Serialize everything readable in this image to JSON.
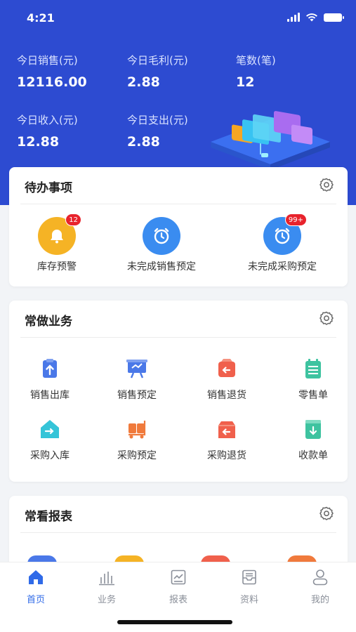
{
  "status_bar": {
    "time": "4:21"
  },
  "stats": [
    {
      "label": "今日销售(元)",
      "value": "12116.00"
    },
    {
      "label": "今日毛利(元)",
      "value": "2.88"
    },
    {
      "label": "笔数(笔)",
      "value": "12"
    },
    {
      "label": "今日收入(元)",
      "value": "12.88"
    },
    {
      "label": "今日支出(元)",
      "value": "2.88"
    }
  ],
  "todo": {
    "title": "待办事项",
    "items": [
      {
        "label": "库存预警",
        "badge": "12",
        "icon": "bell-icon",
        "color": "#f5b325"
      },
      {
        "label": "未完成销售预定",
        "badge": "",
        "icon": "alarm-clock-icon",
        "color": "#3a8cf0"
      },
      {
        "label": "未完成采购预定",
        "badge": "99+",
        "icon": "alarm-clock-icon",
        "color": "#3a8cf0"
      }
    ]
  },
  "business": {
    "title": "常做业务",
    "items": [
      {
        "label": "销售出库",
        "icon": "sales-outbound-icon",
        "color": "#4a78e8"
      },
      {
        "label": "销售预定",
        "icon": "sales-booking-icon",
        "color": "#4a78e8"
      },
      {
        "label": "销售退货",
        "icon": "sales-return-icon",
        "color": "#f0604c"
      },
      {
        "label": "零售单",
        "icon": "retail-order-icon",
        "color": "#3ec3a0"
      },
      {
        "label": "采购入库",
        "icon": "purchase-inbound-icon",
        "color": "#35c4d8"
      },
      {
        "label": "采购预定",
        "icon": "purchase-booking-icon",
        "color": "#f07a3c"
      },
      {
        "label": "采购退货",
        "icon": "purchase-return-icon",
        "color": "#f0604c"
      },
      {
        "label": "收款单",
        "icon": "receipt-icon",
        "color": "#3ec3a0"
      }
    ]
  },
  "reports": {
    "title": "常看报表",
    "icon_colors": [
      "#4a78e8",
      "#f5b325",
      "#f0604c",
      "#f07a3c"
    ]
  },
  "tabbar": {
    "items": [
      {
        "label": "首页",
        "icon": "home-icon",
        "active": true
      },
      {
        "label": "业务",
        "icon": "bar-chart-icon",
        "active": false
      },
      {
        "label": "报表",
        "icon": "report-icon",
        "active": false
      },
      {
        "label": "资料",
        "icon": "inbox-icon",
        "active": false
      },
      {
        "label": "我的",
        "icon": "user-icon",
        "active": false
      }
    ],
    "active_color": "#2f6ae8",
    "inactive_color": "#8a8f99"
  },
  "colors": {
    "brand": "#2d4bd1",
    "badge": "#e8232c"
  }
}
